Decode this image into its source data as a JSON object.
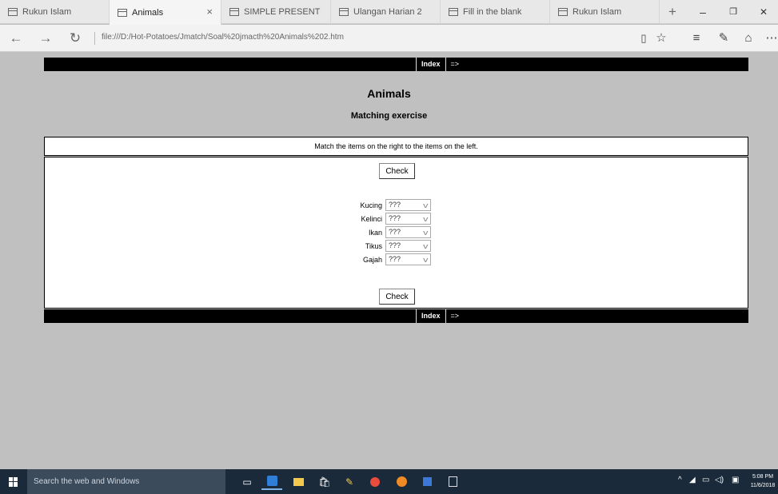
{
  "browser": {
    "tabs": [
      {
        "title": "Rukun Islam",
        "active": false
      },
      {
        "title": "Animals",
        "active": true
      },
      {
        "title": "SIMPLE PRESENT",
        "active": false
      },
      {
        "title": "Ulangan Harian 2",
        "active": false
      },
      {
        "title": "Fill in the blank",
        "active": false
      },
      {
        "title": "Rukun Islam",
        "active": false
      }
    ],
    "url": "file:///D:/Hot-Potatoes/Jmatch/Soal%20jmacth%20Animals%202.htm",
    "new_tab_label": "+",
    "close_tab_label": "×",
    "minimize_label": "–",
    "maximize_label": "❐",
    "close_label": "✕"
  },
  "nav": {
    "index_label": "Index",
    "next_label": "=>"
  },
  "exercise": {
    "title": "Animals",
    "subtitle": "Matching exercise",
    "instructions": "Match the items on the right to the items on the left.",
    "check_label": "Check",
    "placeholder_option": "???",
    "items": [
      {
        "label": "Kucing",
        "selected": "???"
      },
      {
        "label": "Kelinci",
        "selected": "???"
      },
      {
        "label": "Ikan",
        "selected": "???"
      },
      {
        "label": "Tikus",
        "selected": "???"
      },
      {
        "label": "Gajah",
        "selected": "???"
      }
    ]
  },
  "taskbar": {
    "search_placeholder": "Search the web and Windows",
    "time": "5:08 PM",
    "date": "11/6/2018",
    "accent_color": "#7fb3e6"
  }
}
